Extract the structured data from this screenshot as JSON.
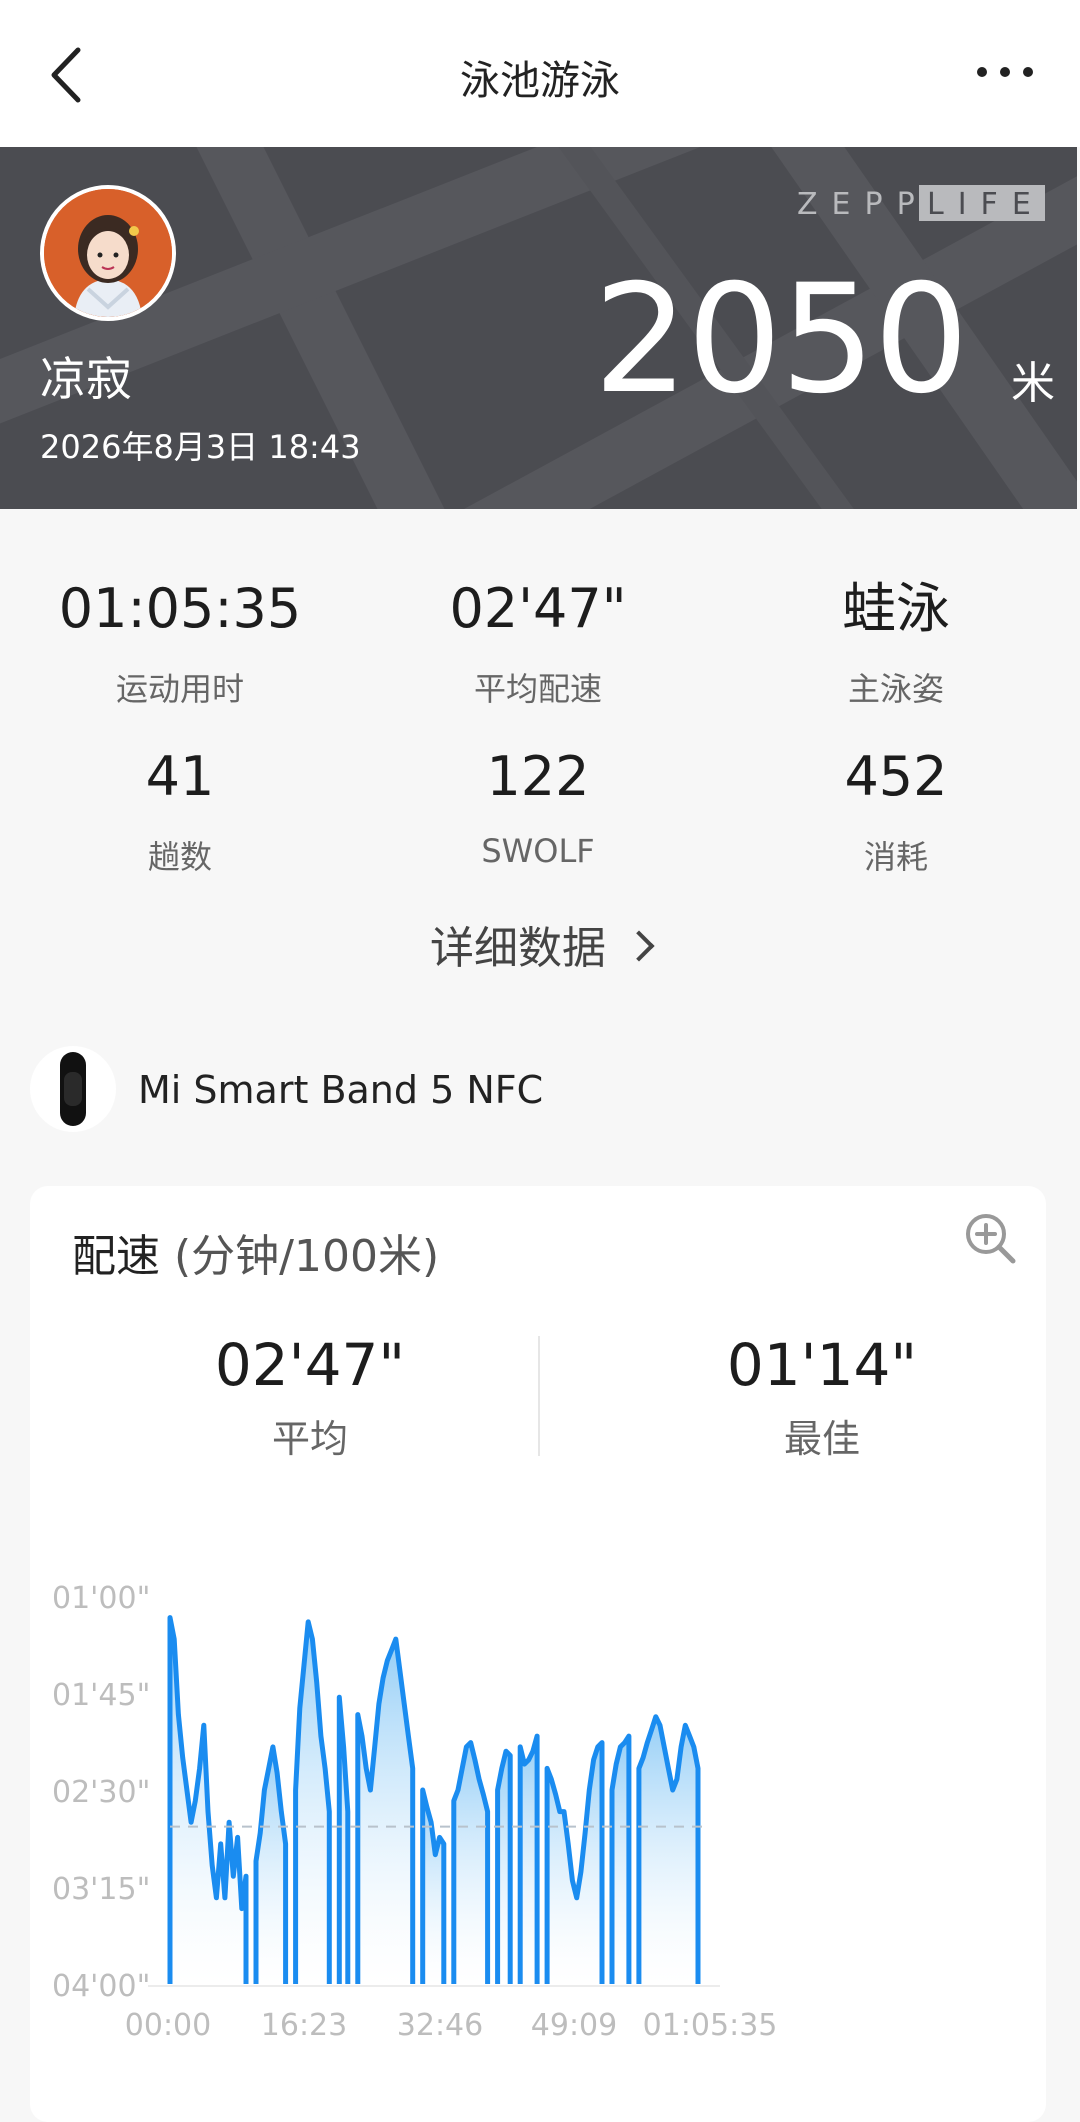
{
  "header": {
    "title": "泳池游泳",
    "back_icon": "chevron-left-icon",
    "more_icon": "more-dots-icon"
  },
  "hero": {
    "username": "凉寂",
    "datetime": "2026年8月3日 18:43",
    "brand": "ZEPP LIFE",
    "distance": "2050",
    "distance_unit": "米"
  },
  "stats": [
    {
      "value": "01:05:35",
      "label": "运动用时"
    },
    {
      "value": "02'47\"",
      "label": "平均配速"
    },
    {
      "value": "蛙泳",
      "label": "主泳姿"
    },
    {
      "value": "41",
      "label": "趟数"
    },
    {
      "value": "122",
      "label": "SWOLF"
    },
    {
      "value": "452",
      "label": "消耗"
    }
  ],
  "detail_link": "详细数据",
  "device": {
    "name": "Mi Smart Band 5 NFC",
    "icon": "smart-band-icon"
  },
  "pace_card": {
    "title": "配速",
    "unit": "(分钟/100米)",
    "zoom_icon": "zoom-in-icon",
    "average_value": "02'47\"",
    "average_label": "平均",
    "best_value": "01'14\"",
    "best_label": "最佳"
  },
  "chart_data": {
    "type": "area",
    "y_axis_reversed": true,
    "yticks": [
      "01'00\"",
      "01'45\"",
      "02'30\"",
      "03'15\"",
      "04'00\""
    ],
    "xticks": [
      "00:00",
      "16:23",
      "32:46",
      "49:09",
      "01:05:35"
    ],
    "average_line": "02'47\"",
    "line_color": "#1a8cf0",
    "fill_color": "#bfe1fa",
    "series_seconds": [
      [
        70,
        80,
        115,
        135,
        150,
        165,
        155,
        140,
        120,
        160,
        185,
        200,
        175,
        200,
        165,
        190,
        172,
        205,
        190
      ],
      [
        183,
        170,
        150,
        140,
        130,
        142,
        160,
        175
      ],
      [
        150,
        112,
        92,
        72,
        80,
        100,
        125,
        140,
        160
      ],
      [
        107,
        130,
        160
      ],
      [
        115,
        125,
        140,
        150,
        130,
        110,
        98,
        90,
        85,
        80,
        95,
        110,
        125,
        140
      ],
      [
        150,
        158,
        165,
        180,
        172,
        175
      ],
      [
        155,
        150,
        140,
        130,
        128,
        136,
        145,
        152,
        160
      ],
      [
        150,
        140,
        132,
        134
      ],
      [
        130,
        138,
        136,
        132,
        125
      ],
      [
        140,
        145,
        152,
        160,
        160,
        175,
        192,
        200,
        188,
        170,
        150,
        136,
        130,
        128
      ],
      [
        150,
        138,
        130,
        128,
        125
      ],
      [
        140,
        135,
        128,
        122,
        116,
        120,
        130,
        140,
        150,
        145,
        130,
        120,
        125,
        130,
        140
      ]
    ]
  }
}
